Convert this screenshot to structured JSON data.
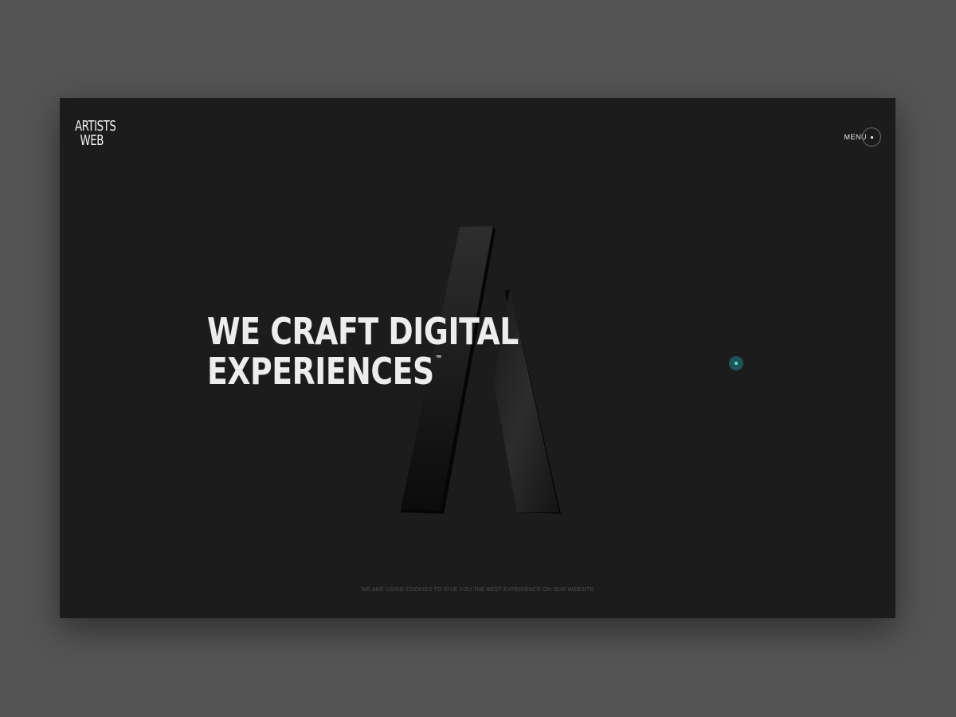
{
  "brand": {
    "line1": "ARTISTS",
    "line2": "WEB"
  },
  "nav": {
    "menu_label": "MENU"
  },
  "hero": {
    "headline_line1": "WE CRAFT DIGITAL",
    "headline_line2": "EXPERIENCES",
    "trademark": "™"
  },
  "footer": {
    "cookie_notice": "WE ARE USING COOKIES TO GIVE YOU THE BEST EXPERIENCE ON OUR WEBSITE"
  },
  "colors": {
    "background": "#1c1c1c",
    "outer_background": "#545454",
    "text": "#ededed",
    "cursor_accent": "#5fe0d8",
    "cursor_ring": "#1f5456"
  },
  "icons": {
    "menu": "menu-circle-icon",
    "cursor": "cursor-dot-icon",
    "hero_shape": "3d-a-logo-shape"
  }
}
